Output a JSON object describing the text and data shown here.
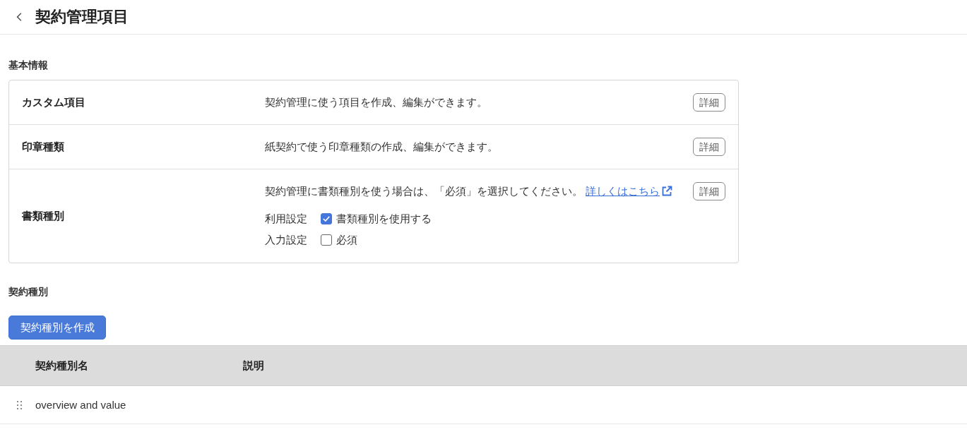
{
  "header": {
    "title": "契約管理項目"
  },
  "basic_info": {
    "heading": "基本情報",
    "rows": [
      {
        "kind": "plain",
        "label": "カスタム項目",
        "description": "契約管理に使う項目を作成、編集ができます。",
        "button": "詳細"
      },
      {
        "kind": "plain",
        "label": "印章種類",
        "description": "紙契約で使う印章種類の作成、編集ができます。",
        "button": "詳細"
      },
      {
        "kind": "settings",
        "label": "書類種別",
        "description": "契約管理に書類種別を使う場合は、「必須」を選択してください。",
        "link": "詳しくはこちら",
        "button": "詳細",
        "settings": [
          {
            "label": "利用設定",
            "option": "書類種別を使用する",
            "checked": true
          },
          {
            "label": "入力設定",
            "option": "必須",
            "checked": false
          }
        ]
      }
    ]
  },
  "contract_types": {
    "heading": "契約種別",
    "create_button": "契約種別を作成",
    "table": {
      "columns": [
        "契約種別名",
        "説明"
      ],
      "rows": [
        {
          "name": "overview and value"
        }
      ]
    }
  }
}
